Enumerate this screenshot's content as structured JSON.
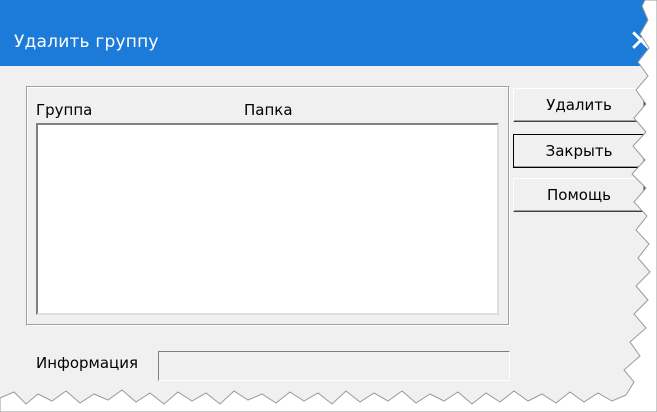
{
  "window": {
    "title": "Удалить группу",
    "close_icon": "close-icon",
    "accent_color": "#1c7ad8"
  },
  "list": {
    "columns": [
      "Группа",
      "Папка"
    ],
    "rows": []
  },
  "buttons": {
    "delete_label": "Удалить",
    "close_label": "Закрыть",
    "help_label": "Помощь"
  },
  "info": {
    "label": "Информация",
    "value": ""
  }
}
